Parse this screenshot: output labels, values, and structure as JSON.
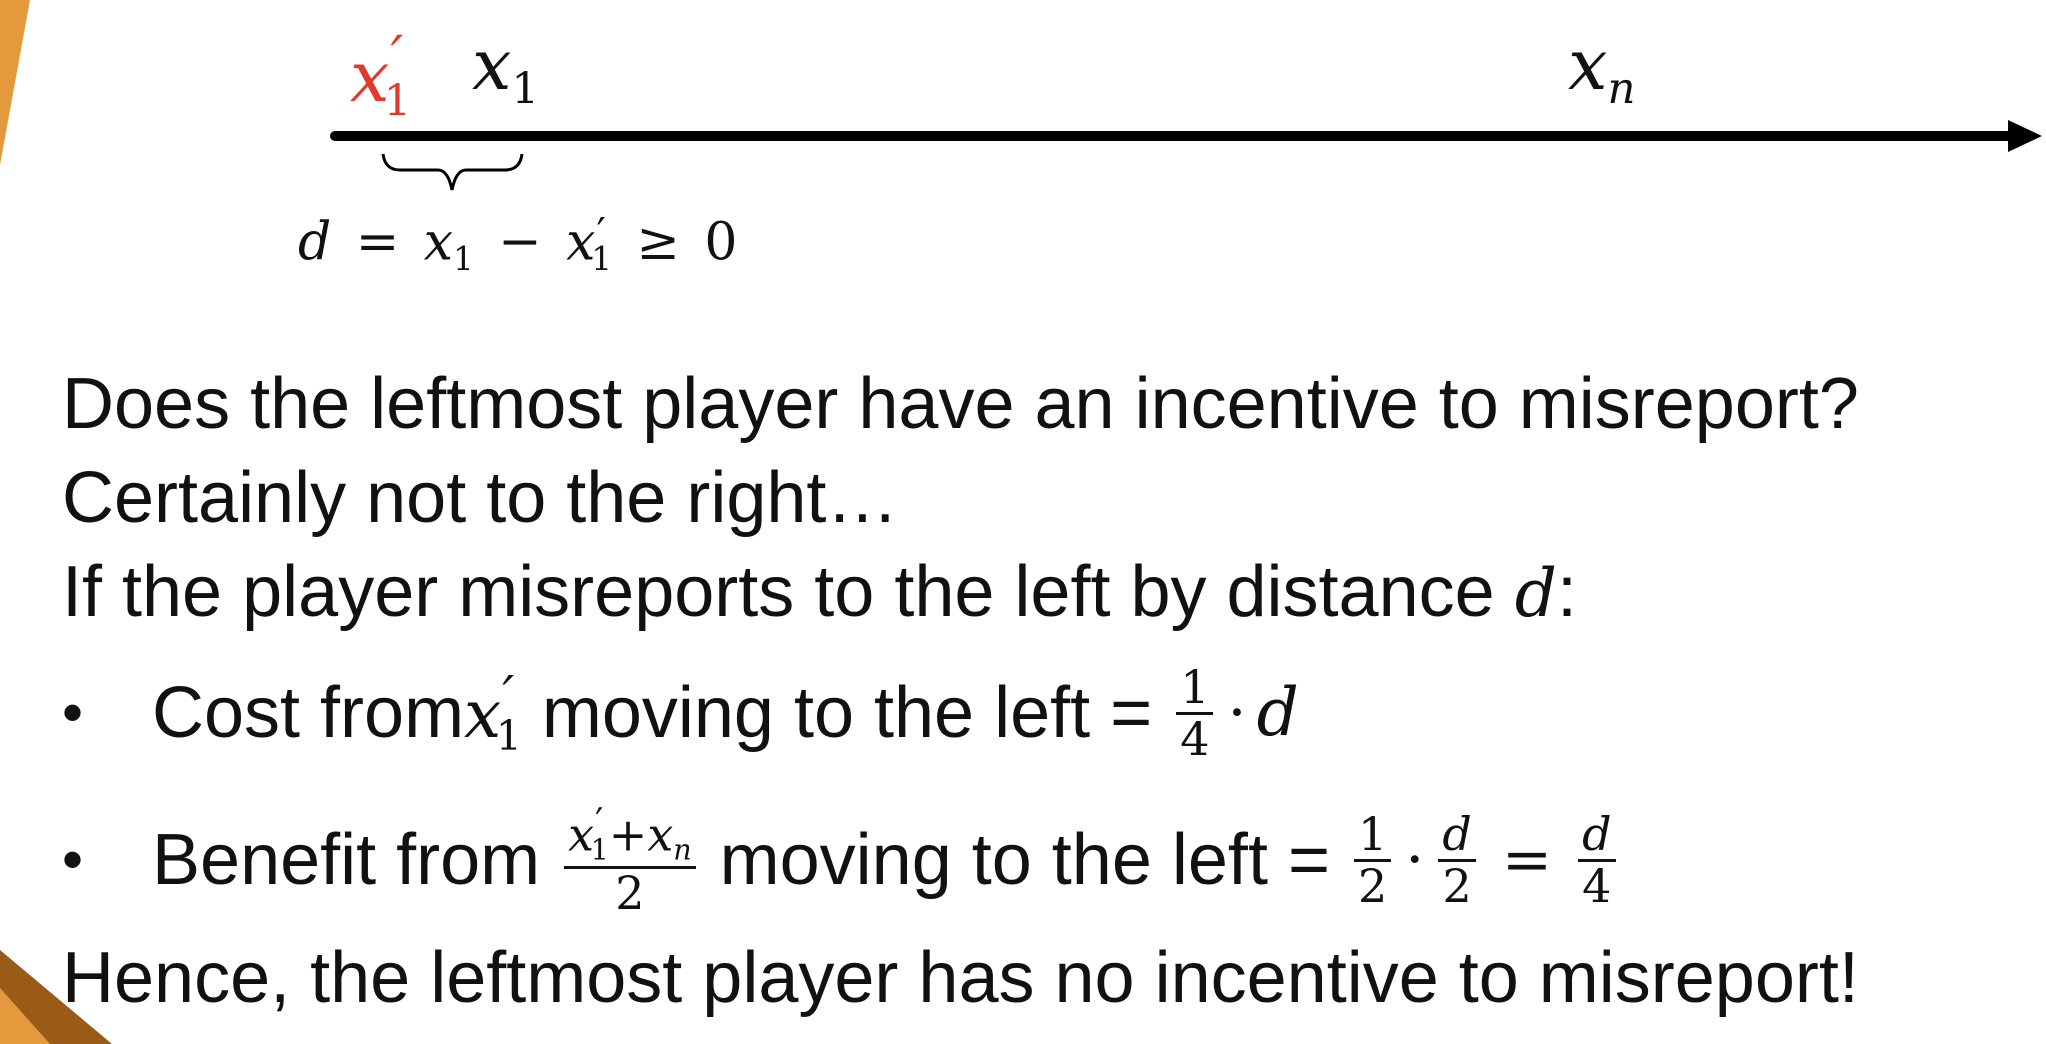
{
  "axis": {
    "label_x1_prime": {
      "base": "x",
      "sub": "1",
      "prime": "′"
    },
    "label_x1": {
      "base": "x",
      "sub": "1"
    },
    "label_xn": {
      "base": "x",
      "sub": "n"
    },
    "distance_equation": {
      "d": "d",
      "eq": "=",
      "x": "x",
      "sub1": "1",
      "minus": "−",
      "x2": "x",
      "sub2": "1",
      "prime": "′",
      "geq": "≥",
      "zero": "0"
    }
  },
  "lines": {
    "line1": "Does the leftmost player have an incentive to misreport?",
    "line2": "Certainly not to the right…",
    "line3_text": "If the player misreports to the left by distance ",
    "line3_var": "d",
    "line3_end": ":",
    "bullet1": {
      "marker": "•",
      "pre": "Cost from ",
      "var_base": "x",
      "var_sub": "1",
      "var_prime": "′",
      "post": " moving to the left = ",
      "frac_num": "1",
      "frac_den": "4",
      "dot": "·",
      "tail": "d"
    },
    "bullet2": {
      "marker": "•",
      "pre": "Benefit from ",
      "frac_num_a": "x",
      "frac_num_a_sub": "1",
      "frac_num_a_prime": "′",
      "frac_num_plus": "+",
      "frac_num_b": "x",
      "frac_num_b_sub": "n",
      "frac_den": "2",
      "post": " moving to the left = ",
      "f1_num": "1",
      "f1_den": "2",
      "dot": "·",
      "f2_num": "d",
      "f2_den": "2",
      "eq": "=",
      "f3_num": "d",
      "f3_den": "4"
    },
    "conclusion": "Hence, the leftmost player has no incentive to misreport!"
  },
  "colors": {
    "accent_red": "#e03a2f",
    "corner_orange": "#e29a3c",
    "corner_brown": "#9a5a18"
  }
}
